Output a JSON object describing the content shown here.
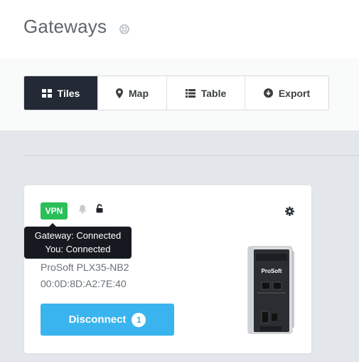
{
  "page": {
    "title": "Gateways",
    "help_icon": "help-icon"
  },
  "views": [
    {
      "label": "Tiles",
      "icon": "tiles-icon",
      "active": true
    },
    {
      "label": "Map",
      "icon": "map-marker-icon",
      "active": false
    },
    {
      "label": "Table",
      "icon": "table-list-icon",
      "active": false
    },
    {
      "label": "Export",
      "icon": "export-icon",
      "active": false
    }
  ],
  "gateway": {
    "vpn_label": "VPN",
    "tooltip_line1": "Gateway: Connected",
    "tooltip_line2": "You: Connected",
    "model": "ProSoft PLX35-NB2",
    "mac": "00:0D:8D:A2:7E:40",
    "button_label": "Disconnect",
    "button_count": "1",
    "device_brand": "ProSoft"
  },
  "colors": {
    "vpn": "#2bbf5a",
    "primary": "#3ab4ee",
    "active_tab": "#232a35"
  }
}
